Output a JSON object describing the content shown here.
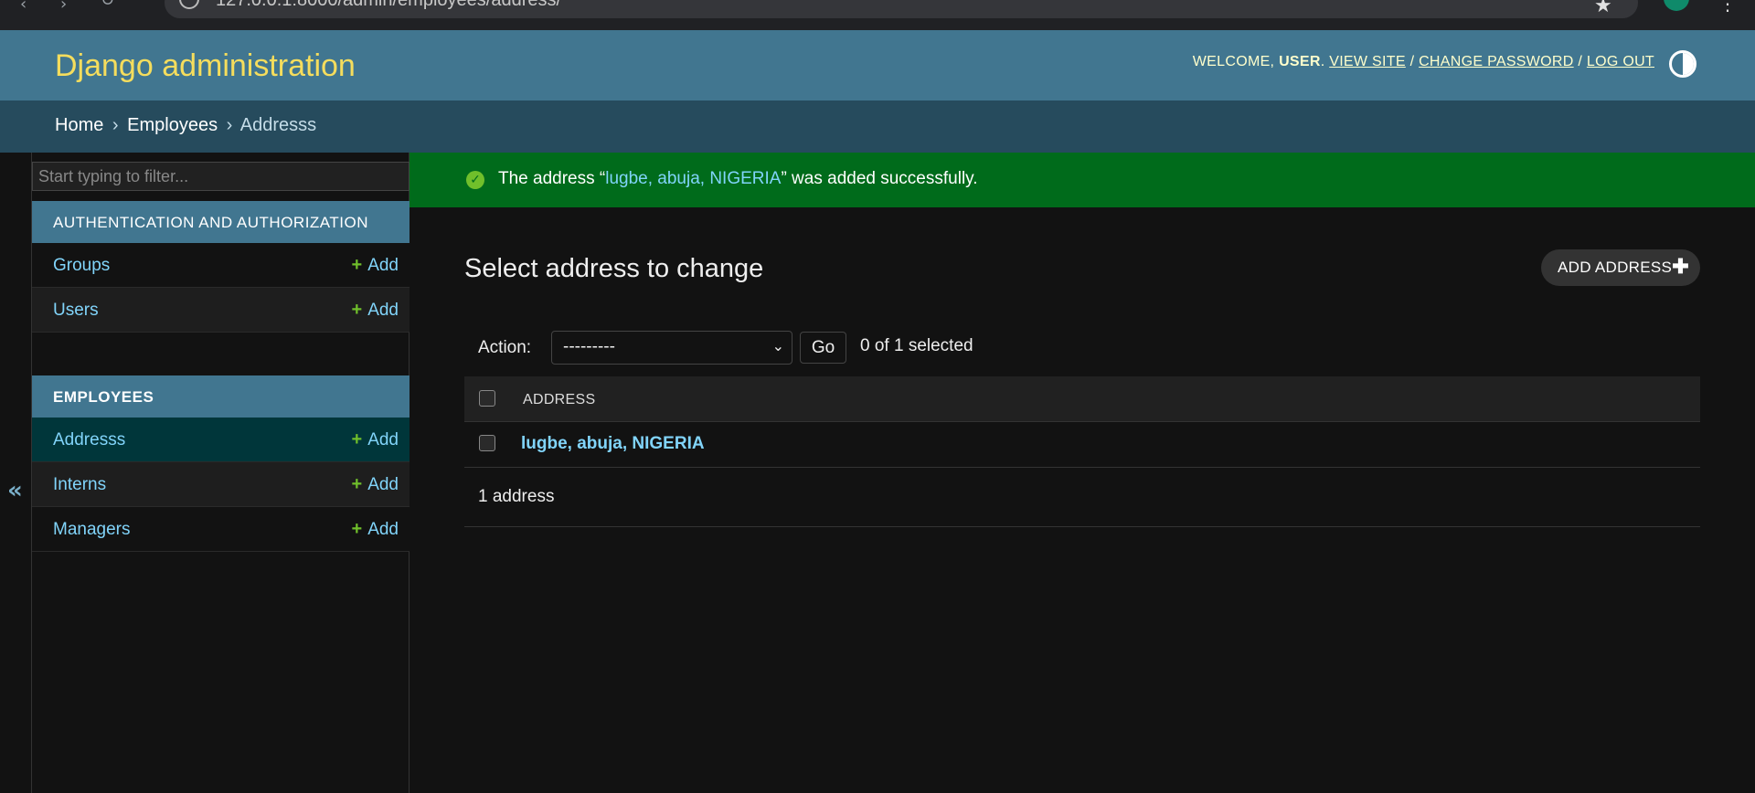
{
  "browser": {
    "url": "127.0.0.1:8000/admin/employees/address/"
  },
  "header": {
    "site_title": "Django administration",
    "welcome": "WELCOME,",
    "username": "USER",
    "view_site": "VIEW SITE",
    "change_password": "CHANGE PASSWORD",
    "log_out": "LOG OUT",
    "separator": "/"
  },
  "breadcrumbs": {
    "home": "Home",
    "app": "Employees",
    "current": "Addresss",
    "sep": "›"
  },
  "sidebar": {
    "collapse_label": "«",
    "filter_placeholder": "Start typing to filter...",
    "apps": [
      {
        "caption": "AUTHENTICATION AND AUTHORIZATION",
        "models": [
          {
            "label": "Groups",
            "add": "Add"
          },
          {
            "label": "Users",
            "add": "Add"
          }
        ]
      },
      {
        "caption": "EMPLOYEES",
        "models": [
          {
            "label": "Addresss",
            "add": "Add"
          },
          {
            "label": "Interns",
            "add": "Add"
          },
          {
            "label": "Managers",
            "add": "Add"
          }
        ]
      }
    ]
  },
  "message": {
    "prefix": "The address “",
    "link": "lugbe, abuja, NIGERIA",
    "suffix": "” was added successfully."
  },
  "content": {
    "title": "Select address to change",
    "add_button": "ADD ADDRESS",
    "action_label": "Action:",
    "action_selected": "---------",
    "go_label": "Go",
    "selected_count": "0 of 1 selected",
    "column_header": "ADDRESS",
    "rows": [
      "lugbe, abuja, NIGERIA"
    ],
    "paginator": "1 address"
  },
  "colors": {
    "header_bg": "#417690",
    "breadcrumb_bg": "#264b5d",
    "site_title": "#f5dd5d",
    "link": "#81d4fa",
    "success_bg": "#006b1b",
    "add_icon": "#70bf2b"
  }
}
